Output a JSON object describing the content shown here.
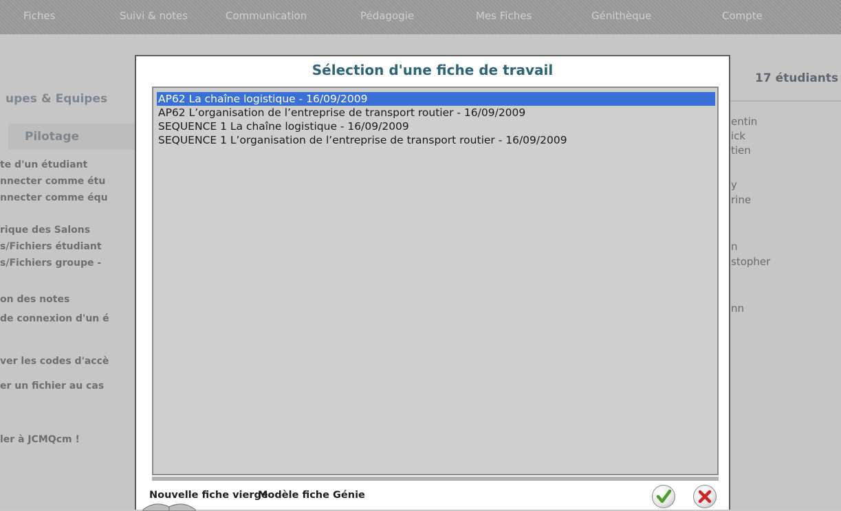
{
  "nav": {
    "items": [
      "Fiches",
      "Suivi & notes",
      "Communication",
      "Pédagogie",
      "Mes Fiches",
      "Génithèque",
      "Compte"
    ]
  },
  "left_panel": {
    "groups_heading": "upes & Equipes",
    "pilotage_heading": "Pilotage",
    "links": [
      "te d'un étudiant",
      "nnecter comme étu",
      "nnecter comme équ",
      "rique des Salons",
      "s/Fichiers étudiant",
      "s/Fichiers groupe -",
      "on des notes",
      "de connexion d'un é",
      "ver les codes d'accè",
      "er un fichier au cas",
      "ler à JCMQcm !"
    ]
  },
  "right_panel": {
    "students_count": "17 étudiants",
    "names": [
      "entin",
      "ick",
      "tien",
      "y",
      "rine",
      "n",
      "stopher",
      "nn"
    ]
  },
  "modal": {
    "title": "Sélection d'une fiche de travail",
    "items": [
      "AP62 La chaîne logistique - 16/09/2009",
      "AP62 L’organisation de l’entreprise de transport routier - 16/09/2009",
      "SEQUENCE 1 La chaîne logistique - 16/09/2009",
      "SEQUENCE 1 L’organisation de l’entreprise de transport routier - 16/09/2009"
    ],
    "selected_index": 0,
    "new_blank_label": "Nouvelle fiche vierge",
    "template_label": "Modèle fiche Génie",
    "confirm_icon": "check-icon",
    "cancel_icon": "close-icon"
  },
  "colors": {
    "selection": "#3a6fd6",
    "title": "#2d6478",
    "confirm": "#4aa02c",
    "cancel": "#d02626"
  }
}
